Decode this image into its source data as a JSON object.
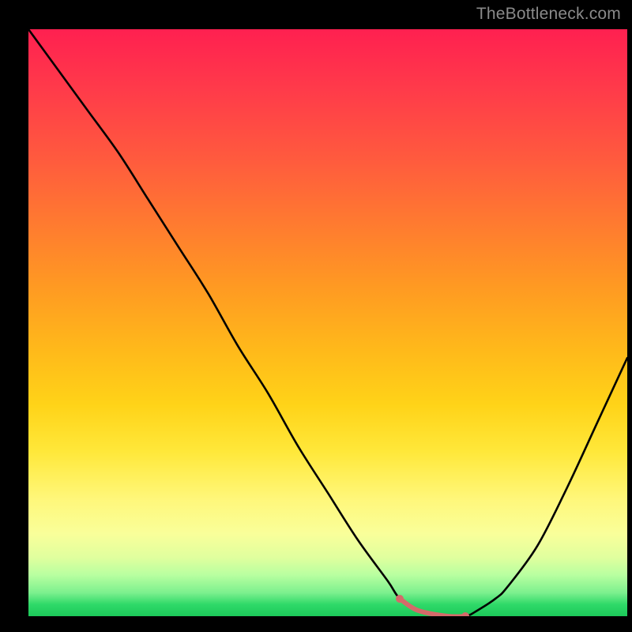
{
  "watermark": "TheBottleneck.com",
  "colors": {
    "curve_stroke": "#000000",
    "marker": "#d46a6a",
    "frame": "#000000"
  },
  "chart_data": {
    "type": "line",
    "title": "",
    "xlabel": "",
    "ylabel": "",
    "xlim": [
      0,
      100
    ],
    "ylim": [
      0,
      100
    ],
    "grid": false,
    "x": [
      0,
      5,
      10,
      15,
      20,
      25,
      30,
      35,
      40,
      45,
      50,
      55,
      60,
      62,
      65,
      70,
      73,
      75,
      78,
      80,
      85,
      90,
      95,
      100
    ],
    "values": [
      100,
      93,
      86,
      79,
      71,
      63,
      55,
      46,
      38,
      29,
      21,
      13,
      6,
      3,
      1,
      0,
      0,
      1,
      3,
      5,
      12,
      22,
      33,
      44
    ],
    "annotations": [
      {
        "type": "highlight_range",
        "x_start": 62,
        "x_end": 73
      }
    ],
    "markers": [
      {
        "x": 62,
        "y": 3
      },
      {
        "x": 73,
        "y": 0
      }
    ]
  }
}
